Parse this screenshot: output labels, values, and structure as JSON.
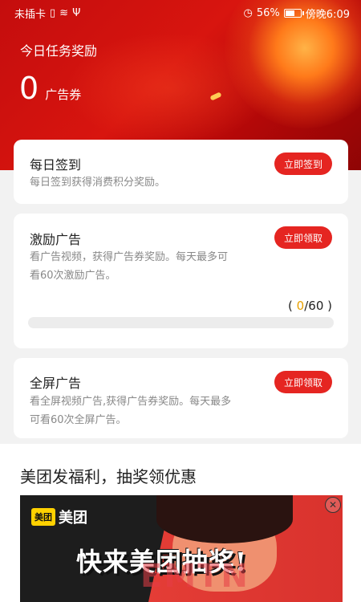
{
  "status_bar": {
    "carrier": "未插卡",
    "battery_percent": "56%",
    "time": "傍晚6:09"
  },
  "header": {
    "title": "今日任务奖励",
    "count": "0",
    "unit": "广告券"
  },
  "tasks": [
    {
      "title": "每日签到",
      "desc": "每日签到获得消费积分奖励。",
      "button": "立即签到"
    },
    {
      "title": "激励广告",
      "desc_line1": "看广告视频，获得广告券奖励。每天最多可",
      "desc_line2": "看60次激励广告。",
      "button": "立即领取",
      "progress": {
        "open": "(",
        "current": "0",
        "sep": "/60",
        "close": ")",
        "fraction": 0.0
      }
    },
    {
      "title": "全屏广告",
      "desc_line1": "看全屏视频广告,获得广告券奖励。每天最多",
      "desc_line2": "可看60次全屏广告。",
      "button": "立即领取"
    }
  ],
  "promo": {
    "title": "美团发福利，抽奖领优惠",
    "logo_badge": "美团",
    "logo_text": "美团",
    "headline": "快来美团抽奖!",
    "close_icon": "close-circle-icon"
  },
  "watermark": "EMTN",
  "colors": {
    "accent": "#e52521",
    "progress": "#e8a000"
  }
}
